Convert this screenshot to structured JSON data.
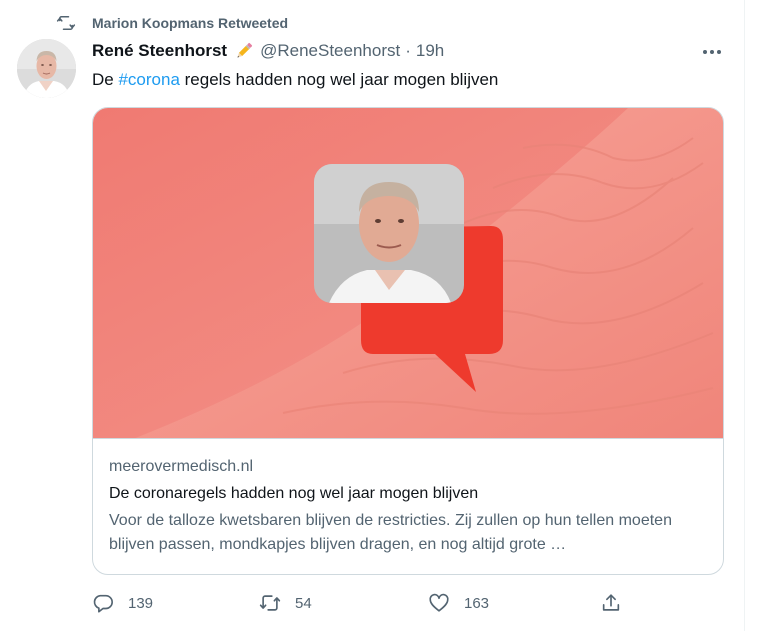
{
  "retweet": {
    "label": "Marion Koopmans Retweeted"
  },
  "tweet": {
    "author_name": "René Steenhorst",
    "emoji": "pencil",
    "handle": "@ReneSteenhorst",
    "separator": "·",
    "time": "19h",
    "text_before": "De ",
    "hashtag": "#corona",
    "text_after": " regels hadden nog wel jaar mogen blijven"
  },
  "card": {
    "domain": "meerovermedisch.nl",
    "title": "De coronaregels hadden nog wel jaar mogen blijven",
    "description": "Voor de talloze kwetsbaren blĳven de restricties. Zij zullen op hun tellen moeten blĳven passen, mondkapjes blijven dragen, en nog altijd grote …"
  },
  "actions": {
    "replies": "139",
    "retweets": "54",
    "likes": "163"
  },
  "colors": {
    "text": "#0f1419",
    "secondary": "#536471",
    "link": "#1d9bf0",
    "border": "#cfd9de",
    "card_red": "#ee3a2d"
  }
}
